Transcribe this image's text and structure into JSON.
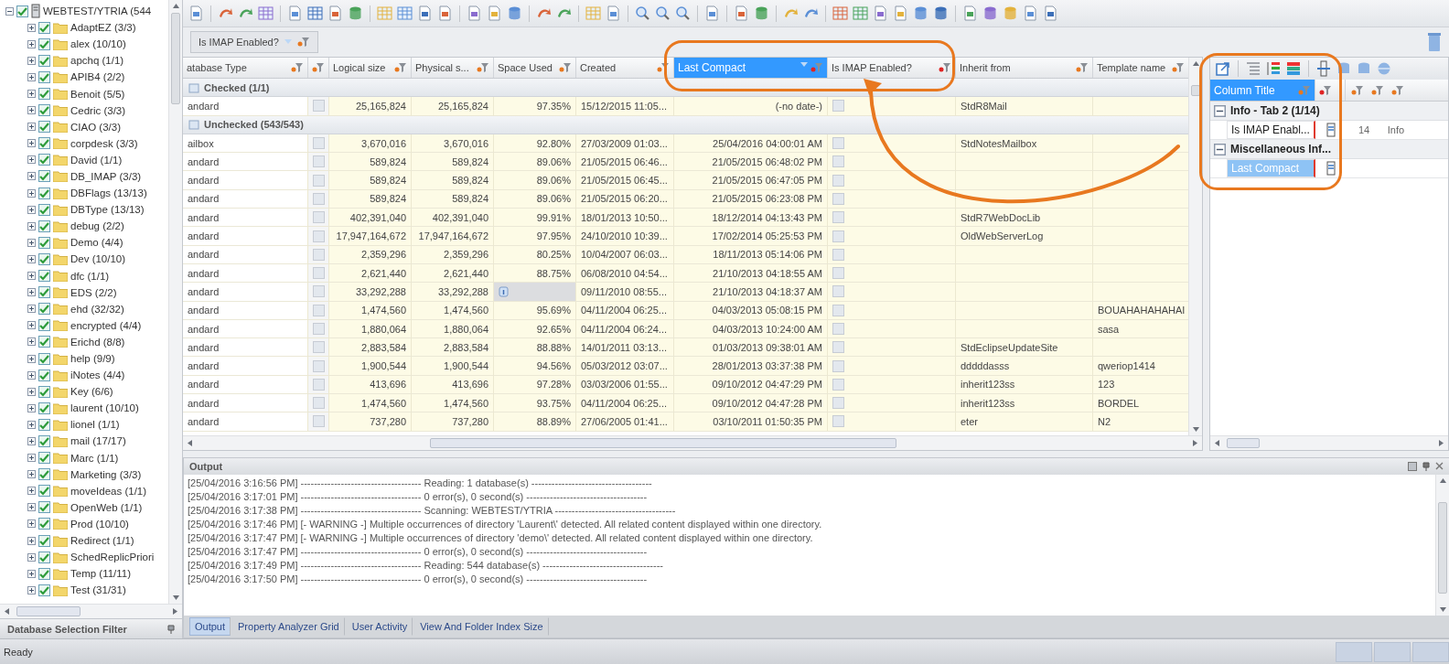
{
  "tree": {
    "root": {
      "label": "WEBTEST/YTRIA (544",
      "checked": true,
      "expanded": true
    },
    "children": [
      {
        "label": "AdaptEZ (3/3)",
        "checked": true
      },
      {
        "label": "alex (10/10)",
        "checked": true
      },
      {
        "label": "apchq (1/1)",
        "checked": true
      },
      {
        "label": "APIB4 (2/2)",
        "checked": true
      },
      {
        "label": "Benoit (5/5)",
        "checked": true
      },
      {
        "label": "Cedric (3/3)",
        "checked": true
      },
      {
        "label": "CIAO (3/3)",
        "checked": true
      },
      {
        "label": "corpdesk (3/3)",
        "checked": true
      },
      {
        "label": "David (1/1)",
        "checked": true
      },
      {
        "label": "DB_IMAP (3/3)",
        "checked": true
      },
      {
        "label": "DBFlags (13/13)",
        "checked": true
      },
      {
        "label": "DBType (13/13)",
        "checked": true
      },
      {
        "label": "debug (2/2)",
        "checked": true
      },
      {
        "label": "Demo (4/4)",
        "checked": true
      },
      {
        "label": "Dev (10/10)",
        "checked": true
      },
      {
        "label": "dfc (1/1)",
        "checked": true
      },
      {
        "label": "EDS (2/2)",
        "checked": true
      },
      {
        "label": "ehd (32/32)",
        "checked": true
      },
      {
        "label": "encrypted (4/4)",
        "checked": true
      },
      {
        "label": "Erichd (8/8)",
        "checked": true
      },
      {
        "label": "help (9/9)",
        "checked": true
      },
      {
        "label": "iNotes (4/4)",
        "checked": true
      },
      {
        "label": "Key (6/6)",
        "checked": true
      },
      {
        "label": "laurent (10/10)",
        "checked": true
      },
      {
        "label": "lionel (1/1)",
        "checked": true
      },
      {
        "label": "mail (17/17)",
        "checked": true
      },
      {
        "label": "Marc (1/1)",
        "checked": true
      },
      {
        "label": "Marketing (3/3)",
        "checked": true
      },
      {
        "label": "moveIdeas (1/1)",
        "checked": true
      },
      {
        "label": "OpenWeb (1/1)",
        "checked": true
      },
      {
        "label": "Prod (10/10)",
        "checked": true
      },
      {
        "label": "Redirect (1/1)",
        "checked": true
      },
      {
        "label": "SchedReplicPriori",
        "checked": true
      },
      {
        "label": "Temp (11/11)",
        "checked": true
      },
      {
        "label": "Test (31/31)",
        "checked": true
      }
    ],
    "footer": "Database Selection Filter"
  },
  "group_by": {
    "label": "Is IMAP Enabled?"
  },
  "columns": [
    {
      "kind": "text",
      "label": "atabase Type",
      "selected": false
    },
    {
      "kind": "check",
      "selected": false
    },
    {
      "kind": "text",
      "label": "Logical size",
      "selected": false
    },
    {
      "kind": "text",
      "label": "Physical s...",
      "selected": false
    },
    {
      "kind": "text",
      "label": "Space Used",
      "selected": false
    },
    {
      "kind": "text",
      "label": "Created",
      "selected": false
    },
    {
      "kind": "text",
      "label": "Last Compact",
      "selected": true
    },
    {
      "kind": "check",
      "label": "Is IMAP Enabled?",
      "selected": false
    },
    {
      "kind": "text",
      "label": "Inherit from",
      "selected": false
    },
    {
      "kind": "text",
      "label": "Template name",
      "selected": false
    }
  ],
  "groups": [
    {
      "label": "Checked (1/1)",
      "rows": [
        {
          "type": "andard",
          "checked": false,
          "logical": "25,165,824",
          "physical": "25,165,824",
          "space_used": "97.35%",
          "created": "15/12/2015 11:05...",
          "last_compact": "(-no date-)",
          "imap": false,
          "inherit": "StdR8Mail"
        }
      ]
    },
    {
      "label": "Unchecked (543/543)",
      "rows": [
        {
          "type": "ailbox",
          "checked": false,
          "logical": "3,670,016",
          "physical": "3,670,016",
          "space_used": "92.80%",
          "created": "27/03/2009 01:03...",
          "last_compact": "25/04/2016 04:00:01 AM",
          "imap": false,
          "inherit": "StdNotesMailbox"
        },
        {
          "type": "andard",
          "checked": false,
          "logical": "589,824",
          "physical": "589,824",
          "space_used": "89.06%",
          "created": "21/05/2015 06:46...",
          "last_compact": "21/05/2015 06:48:02 PM",
          "imap": false
        },
        {
          "type": "andard",
          "checked": false,
          "logical": "589,824",
          "physical": "589,824",
          "space_used": "89.06%",
          "created": "21/05/2015 06:45...",
          "last_compact": "21/05/2015 06:47:05 PM",
          "imap": false
        },
        {
          "type": "andard",
          "checked": false,
          "logical": "589,824",
          "physical": "589,824",
          "space_used": "89.06%",
          "created": "21/05/2015 06:20...",
          "last_compact": "21/05/2015 06:23:08 PM",
          "imap": false
        },
        {
          "type": "andard",
          "checked": false,
          "logical": "402,391,040",
          "physical": "402,391,040",
          "space_used": "99.91%",
          "created": "18/01/2013 10:50...",
          "last_compact": "18/12/2014 04:13:43 PM",
          "imap": false,
          "inherit": "StdR7WebDocLib"
        },
        {
          "type": "andard",
          "checked": false,
          "logical": "17,947,164,672",
          "physical": "17,947,164,672",
          "space_used": "97.95%",
          "created": "24/10/2010 10:39...",
          "last_compact": "17/02/2014 05:25:53 PM",
          "imap": false,
          "inherit": "OldWebServerLog"
        },
        {
          "type": "andard",
          "checked": false,
          "logical": "2,359,296",
          "physical": "2,359,296",
          "space_used": "80.25%",
          "created": "10/04/2007 06:03...",
          "last_compact": "18/11/2013 05:14:06 PM",
          "imap": false
        },
        {
          "type": "andard",
          "checked": false,
          "logical": "2,621,440",
          "physical": "2,621,440",
          "space_used": "88.75%",
          "created": "06/08/2010 04:54...",
          "last_compact": "21/10/2013 04:18:55 AM",
          "imap": false
        },
        {
          "type": "andard",
          "checked": false,
          "logical": "33,292,288",
          "physical": "33,292,288",
          "created": "09/11/2010 08:55...",
          "last_compact": "21/10/2013 04:18:37 AM",
          "imap": false
        },
        {
          "type": "andard",
          "checked": false,
          "logical": "1,474,560",
          "physical": "1,474,560",
          "space_used": "95.69%",
          "created": "04/11/2004 06:25...",
          "last_compact": "04/03/2013 05:08:15 PM",
          "imap": false,
          "template": "BOUAHAHAHAHAI"
        },
        {
          "type": "andard",
          "checked": false,
          "logical": "1,880,064",
          "physical": "1,880,064",
          "space_used": "92.65%",
          "created": "04/11/2004 06:24...",
          "last_compact": "04/03/2013 10:24:00 AM",
          "imap": false,
          "template": "sasa"
        },
        {
          "type": "andard",
          "checked": false,
          "logical": "2,883,584",
          "physical": "2,883,584",
          "space_used": "88.88%",
          "created": "14/01/2011 03:13...",
          "last_compact": "01/03/2013 09:38:01 AM",
          "imap": false,
          "inherit": "StdEclipseUpdateSite"
        },
        {
          "type": "andard",
          "checked": false,
          "logical": "1,900,544",
          "physical": "1,900,544",
          "space_used": "94.56%",
          "created": "05/03/2012 03:07...",
          "last_compact": "28/01/2013 03:37:38 PM",
          "imap": false,
          "inherit": "dddddasss",
          "template": "qweriop1414"
        },
        {
          "type": "andard",
          "checked": false,
          "logical": "413,696",
          "physical": "413,696",
          "space_used": "97.28%",
          "created": "03/03/2006 01:55...",
          "last_compact": "09/10/2012 04:47:29 PM",
          "imap": false,
          "inherit": "inherit123ss",
          "template": "123"
        },
        {
          "type": "andard",
          "checked": false,
          "logical": "1,474,560",
          "physical": "1,474,560",
          "space_used": "93.75%",
          "created": "04/11/2004 06:25...",
          "last_compact": "09/10/2012 04:47:28 PM",
          "imap": false,
          "inherit": "inherit123ss",
          "template": "BORDEL"
        },
        {
          "type": "andard",
          "checked": false,
          "logical": "737,280",
          "physical": "737,280",
          "space_used": "88.89%",
          "created": "27/06/2005 01:41...",
          "last_compact": "03/10/2011 01:50:35 PM",
          "imap": false,
          "inherit": "eter",
          "template": "N2"
        }
      ]
    }
  ],
  "column_panel": {
    "header": "Column Title",
    "groups": [
      {
        "label": "Info - Tab 2 (1/14)",
        "expanded": true,
        "items": [
          {
            "label": "Is IMAP Enabl...",
            "selected": false,
            "count": "14",
            "tab": "Info"
          }
        ]
      },
      {
        "label": "Miscellaneous Inf...",
        "expanded": true,
        "items": [
          {
            "label": "Last Compact",
            "selected": true
          }
        ]
      }
    ]
  },
  "output": {
    "title": "Output",
    "lines": [
      "[25/04/2016 3:16:56 PM] ------------------------------------ Reading: 1 database(s) ------------------------------------",
      "[25/04/2016 3:17:01 PM] ------------------------------------ 0 error(s), 0 second(s) ------------------------------------",
      "[25/04/2016 3:17:38 PM] ------------------------------------ Scanning: WEBTEST/YTRIA ------------------------------------",
      "[25/04/2016 3:17:46 PM] [- WARNING -] Multiple occurrences of directory 'Laurent\\' detected. All related content displayed within one directory.",
      "[25/04/2016 3:17:47 PM] [- WARNING -] Multiple occurrences of directory 'demo\\' detected. All related content displayed within one directory.",
      "[25/04/2016 3:17:47 PM] ------------------------------------ 0 error(s), 0 second(s) ------------------------------------",
      "[25/04/2016 3:17:49 PM] ------------------------------------ Reading: 544 database(s) ------------------------------------",
      "[25/04/2016 3:17:50 PM] ------------------------------------ 0 error(s), 0 second(s) ------------------------------------"
    ]
  },
  "tabs": [
    {
      "label": "Output",
      "selected": true
    },
    {
      "label": "Property Analyzer Grid",
      "selected": false
    },
    {
      "label": "User Activity",
      "selected": false
    },
    {
      "label": "View And Folder Index Size",
      "selected": false
    }
  ],
  "status_bar": {
    "text": "Ready"
  }
}
